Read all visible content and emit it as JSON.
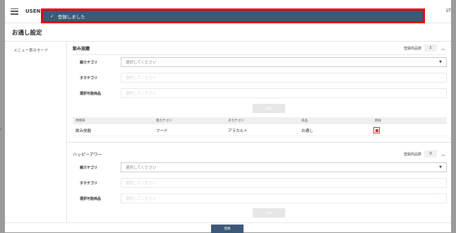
{
  "app": {
    "name": "USEN"
  },
  "toast": {
    "message": "登録しました"
  },
  "page": {
    "title": "お通し設定"
  },
  "sidebar": {
    "items": [
      {
        "label": "メニュー表示モード"
      }
    ]
  },
  "sections": [
    {
      "name": "飲み放題",
      "count_label": "登録商品数",
      "count": "1",
      "fields": [
        {
          "label": "親カテゴリ",
          "placeholder": "選択してください",
          "enabled": true
        },
        {
          "label": "子カテゴリ",
          "placeholder": "選択してください",
          "enabled": false
        },
        {
          "label": "選択可能商品",
          "placeholder": "選択してください",
          "enabled": false
        }
      ],
      "add_label": "追加",
      "table": {
        "headers": [
          "時間帯",
          "親カテゴリ",
          "子カテゴリ",
          "商品",
          "削除"
        ],
        "rows": [
          [
            "飲み放題",
            "フード",
            "アラカルト",
            "お通し"
          ]
        ]
      }
    },
    {
      "name": "ハッピーアワー",
      "count_label": "登録商品数",
      "count": "0",
      "fields": [
        {
          "label": "親カテゴリ",
          "placeholder": "選択してください",
          "enabled": true
        },
        {
          "label": "子カテゴリ",
          "placeholder": "選択してください",
          "enabled": false
        },
        {
          "label": "選択可能商品",
          "placeholder": "選択してください",
          "enabled": false
        }
      ],
      "add_label": "追加"
    }
  ],
  "footer": {
    "submit_label": "登録"
  },
  "colors": {
    "accent": "#3d5878",
    "highlight_border": "#ee0000",
    "delete": "#cc3333"
  }
}
